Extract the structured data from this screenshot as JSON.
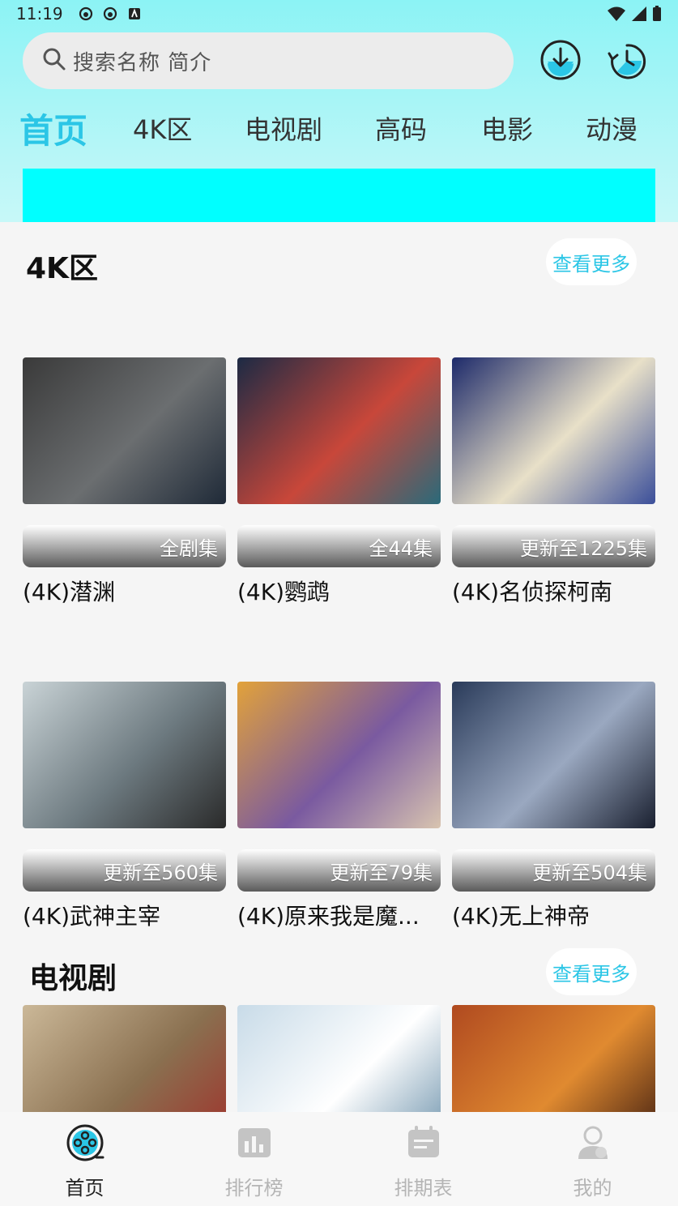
{
  "status_bar": {
    "time": "11:19"
  },
  "search": {
    "placeholder": "搜索名称 简介"
  },
  "tabs": [
    {
      "label": "首页",
      "active": true
    },
    {
      "label": "4K区"
    },
    {
      "label": "电视剧"
    },
    {
      "label": "高码"
    },
    {
      "label": "电影"
    },
    {
      "label": "动漫"
    }
  ],
  "sections": [
    {
      "title": "4K区",
      "more": "查看更多",
      "items": [
        {
          "title": "(4K)潜渊",
          "badge": "全剧集",
          "colors": [
            "#3a3a3a",
            "#6b6e70",
            "#1f2a38"
          ]
        },
        {
          "title": "(4K)鹦鹉",
          "badge": "全44集",
          "colors": [
            "#1c2a44",
            "#c8473a",
            "#2a6a7a"
          ]
        },
        {
          "title": "(4K)名侦探柯南",
          "badge": "更新至1225集",
          "colors": [
            "#1d2a6a",
            "#e8e0c8",
            "#3b4f9a"
          ]
        },
        {
          "title": "(4K)武神主宰",
          "badge": "更新至560集",
          "colors": [
            "#c9d3d6",
            "#6d7a80",
            "#2a2a2a"
          ]
        },
        {
          "title": "(4K)原来我是魔...",
          "badge": "更新至79集",
          "colors": [
            "#e2a23a",
            "#7a5aa0",
            "#d8c4b0"
          ]
        },
        {
          "title": "(4K)无上神帝",
          "badge": "更新至504集",
          "colors": [
            "#2a3b5a",
            "#9aa8c0",
            "#1a2030"
          ]
        }
      ]
    },
    {
      "title": "电视剧",
      "more": "查看更多",
      "items": [
        {
          "colors": [
            "#cbb898",
            "#8a7050",
            "#a0302a"
          ]
        },
        {
          "colors": [
            "#c8dbe8",
            "#ffffff",
            "#6a90aa"
          ]
        },
        {
          "colors": [
            "#b04a20",
            "#e08a30",
            "#3a1a10"
          ]
        }
      ]
    }
  ],
  "bottom_nav": [
    {
      "label": "首页",
      "icon": "film-reel-icon",
      "active": true
    },
    {
      "label": "排行榜",
      "icon": "chart-icon"
    },
    {
      "label": "排期表",
      "icon": "calendar-icon"
    },
    {
      "label": "我的",
      "icon": "user-icon"
    }
  ],
  "colors": {
    "accent": "#2bc6e6",
    "banner": "#00ffff"
  }
}
